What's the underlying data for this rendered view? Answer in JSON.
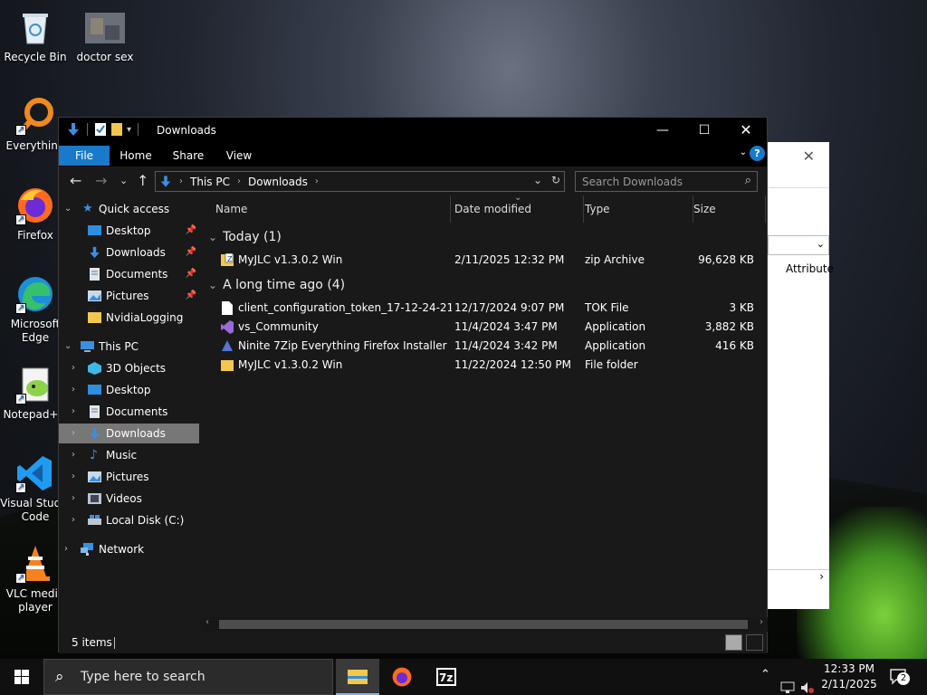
{
  "desktop": {
    "icons": [
      {
        "label": "Recycle Bin"
      },
      {
        "label": "doctor sex"
      },
      {
        "label": "Everything"
      },
      {
        "label": "Firefox"
      },
      {
        "label": "Microsoft Edge"
      },
      {
        "label": "Notepad++"
      },
      {
        "label": "Visual Studio Code"
      },
      {
        "label": "VLC media player"
      }
    ]
  },
  "background_window": {
    "attribute_label": "Attribute"
  },
  "explorer": {
    "title": "Downloads",
    "ribbon_tabs": [
      "File",
      "Home",
      "Share",
      "View"
    ],
    "breadcrumb": [
      "This PC",
      "Downloads"
    ],
    "search_placeholder": "Search Downloads",
    "sidebar": {
      "quick_access": "Quick access",
      "quick_items": [
        "Desktop",
        "Downloads",
        "Documents",
        "Pictures",
        "NvidiaLogging"
      ],
      "this_pc": "This PC",
      "pc_items": [
        "3D Objects",
        "Desktop",
        "Documents",
        "Downloads",
        "Music",
        "Pictures",
        "Videos",
        "Local Disk (C:)"
      ],
      "network": "Network",
      "selected": "Downloads"
    },
    "columns": [
      "Name",
      "Date modified",
      "Type",
      "Size"
    ],
    "groups": [
      {
        "label": "Today (1)",
        "files": [
          {
            "name": "MyJLC v1.3.0.2 Win",
            "date": "2/11/2025 12:32 PM",
            "type": "zip Archive",
            "size": "96,628 KB",
            "icon": "zip-icon"
          }
        ]
      },
      {
        "label": "A long time ago (4)",
        "files": [
          {
            "name": "client_configuration_token_17-12-24-21-...",
            "date": "12/17/2024 9:07 PM",
            "type": "TOK File",
            "size": "3 KB",
            "icon": "file-icon"
          },
          {
            "name": "vs_Community",
            "date": "11/4/2024 3:47 PM",
            "type": "Application",
            "size": "3,882 KB",
            "icon": "visual-studio-icon"
          },
          {
            "name": "Ninite 7Zip Everything Firefox Installer",
            "date": "11/4/2024 3:42 PM",
            "type": "Application",
            "size": "416 KB",
            "icon": "ninite-icon"
          },
          {
            "name": "MyJLC v1.3.0.2 Win",
            "date": "11/22/2024 12:50 PM",
            "type": "File folder",
            "size": "",
            "icon": "folder-icon"
          }
        ]
      }
    ],
    "status": {
      "item_count": "5 items"
    }
  },
  "taskbar": {
    "search_placeholder": "Type here to search",
    "time": "12:33 PM",
    "date": "2/11/2025",
    "notification_count": "2"
  },
  "colors": {
    "accent": "#1979ca",
    "folder": "#f3c74f",
    "selected_row": "#777777"
  }
}
